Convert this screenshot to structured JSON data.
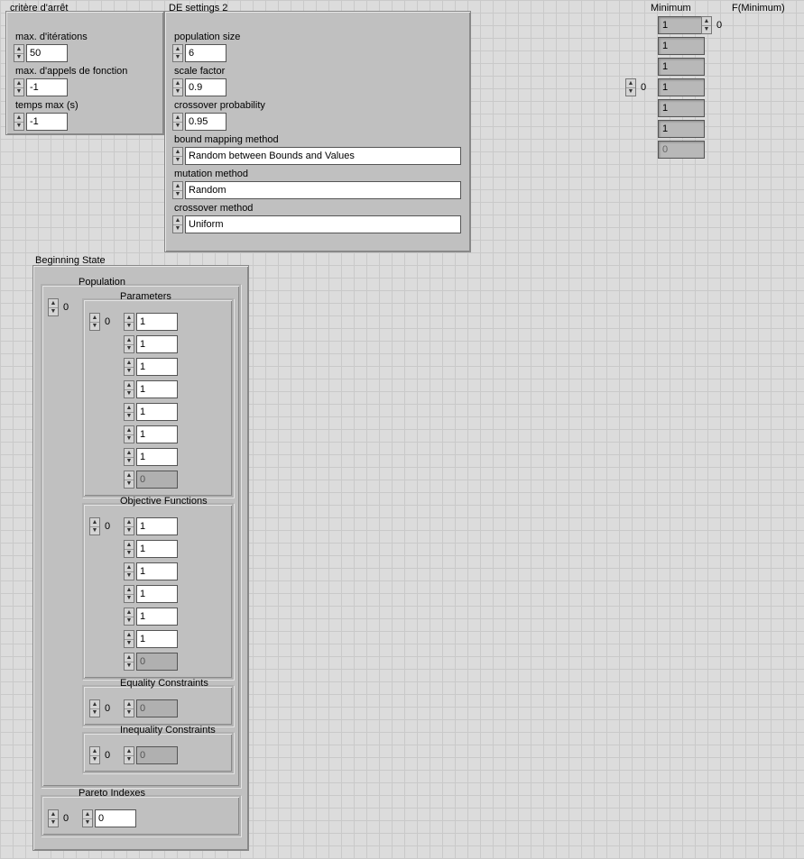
{
  "critere": {
    "title": "critère d'arrêt",
    "max_iter_label": "max. d'itérations",
    "max_iter_value": "50",
    "max_calls_label": "max. d'appels de fonction",
    "max_calls_value": "-1",
    "max_time_label": "temps max (s)",
    "max_time_value": "-1"
  },
  "de": {
    "title": "DE settings 2",
    "pop_size_label": "population size",
    "pop_size_value": "6",
    "scale_label": "scale factor",
    "scale_value": "0.9",
    "cross_prob_label": "crossover probability",
    "cross_prob_value": "0.95",
    "bound_label": "bound mapping method",
    "bound_value": "Random between Bounds and Values",
    "mutation_label": "mutation method",
    "mutation_value": "Random",
    "cross_method_label": "crossover method",
    "cross_method_value": "Uniform"
  },
  "minimum": {
    "label": "Minimum",
    "index": "0",
    "items": [
      "1",
      "1",
      "1",
      "1",
      "1",
      "1",
      "0"
    ]
  },
  "fmin": {
    "label": "F(Minimum)",
    "index": "0"
  },
  "beg": {
    "title": "Beginning State",
    "pop_title": "Population",
    "pop_index": "0",
    "params_title": "Parameters",
    "params_index": "0",
    "params_items": [
      "1",
      "1",
      "1",
      "1",
      "1",
      "1",
      "1",
      "0"
    ],
    "obj_title": "Objective Functions",
    "obj_index": "0",
    "obj_items": [
      "1",
      "1",
      "1",
      "1",
      "1",
      "1",
      "0"
    ],
    "eq_title": "Equality Constraints",
    "eq_index": "0",
    "eq_items": [
      "0"
    ],
    "ineq_title": "Inequality Constraints",
    "ineq_index": "0",
    "ineq_items": [
      "0"
    ],
    "pareto_title": "Pareto Indexes",
    "pareto_index": "0",
    "pareto_value": "0"
  }
}
